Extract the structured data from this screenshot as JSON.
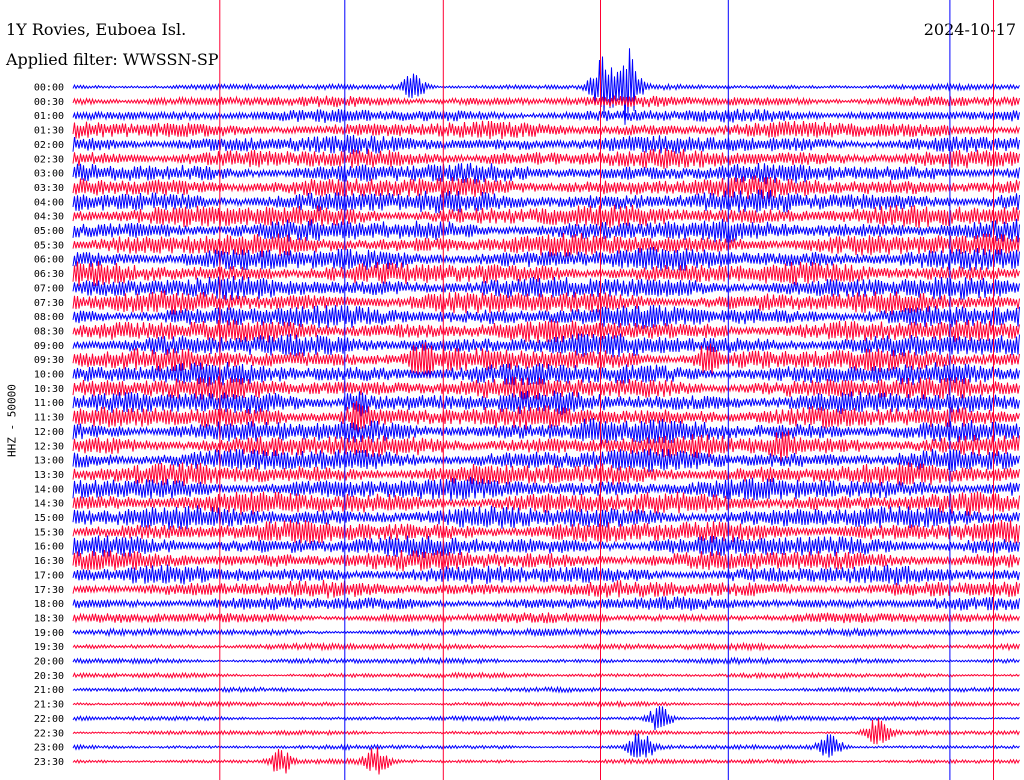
{
  "header": {
    "station": "1Y Rovies, Euboea Isl.",
    "filter": "Applied filter: WWSSN-SP",
    "date": "2024-10-17"
  },
  "chart_data": {
    "type": "line",
    "title": "1Y Rovies, Euboea Isl.",
    "subtitle": "Applied filter: WWSSN-SP",
    "date": "2024-10-17",
    "ylabel": "HHZ - 50000",
    "row_labels": [
      "00:00",
      "00:30",
      "01:00",
      "01:30",
      "02:00",
      "02:30",
      "03:00",
      "03:30",
      "04:00",
      "04:30",
      "05:00",
      "05:30",
      "06:00",
      "06:30",
      "07:00",
      "07:30",
      "08:00",
      "08:30",
      "09:00",
      "09:30",
      "10:00",
      "10:30",
      "11:00",
      "11:30",
      "12:00",
      "12:30",
      "13:00",
      "13:30",
      "14:00",
      "14:30",
      "15:00",
      "15:30",
      "16:00",
      "16:30",
      "17:00",
      "17:30",
      "18:00",
      "18:30",
      "19:00",
      "19:30",
      "20:00",
      "20:30",
      "21:00",
      "21:30",
      "22:00",
      "22:30",
      "23:00",
      "23:30"
    ],
    "colors": [
      "#0000ff",
      "#ff0033"
    ],
    "noise_level": [
      0.25,
      0.5,
      0.6,
      0.75,
      0.8,
      0.85,
      0.9,
      0.95,
      1,
      1,
      1,
      1,
      1,
      1,
      1,
      1,
      1,
      1,
      1,
      1,
      1,
      1,
      1,
      1,
      1,
      1,
      1,
      1,
      1,
      1,
      1,
      1,
      0.95,
      0.9,
      0.85,
      0.75,
      0.6,
      0.45,
      0.3,
      0.28,
      0.25,
      0.22,
      0.2,
      0.2,
      0.2,
      0.2,
      0.2,
      0.2
    ],
    "events": [
      {
        "row": 0,
        "t": 0.56,
        "amp": 2.8
      },
      {
        "row": 0,
        "t": 0.585,
        "amp": 3.6
      },
      {
        "row": 0,
        "t": 0.36,
        "amp": 1.2
      },
      {
        "row": 19,
        "t": 0.37,
        "amp": 1.4
      },
      {
        "row": 19,
        "t": 0.67,
        "amp": 1.2
      },
      {
        "row": 22,
        "t": 0.3,
        "amp": 1.0
      },
      {
        "row": 23,
        "t": 0.3,
        "amp": 1.0
      },
      {
        "row": 24,
        "t": 0.55,
        "amp": 1.0
      },
      {
        "row": 25,
        "t": 0.75,
        "amp": 1.1
      },
      {
        "row": 44,
        "t": 0.62,
        "amp": 1.2
      },
      {
        "row": 45,
        "t": 0.85,
        "amp": 1.3
      },
      {
        "row": 46,
        "t": 0.6,
        "amp": 1.4
      },
      {
        "row": 46,
        "t": 0.8,
        "amp": 1.2
      },
      {
        "row": 47,
        "t": 0.22,
        "amp": 1.2
      },
      {
        "row": 47,
        "t": 0.32,
        "amp": 1.3
      }
    ],
    "spikes": [
      {
        "t": 0.155,
        "color": "#ff0033"
      },
      {
        "t": 0.287,
        "color": "#0000ff"
      },
      {
        "t": 0.391,
        "color": "#ff0033"
      },
      {
        "t": 0.557,
        "color": "#ff0033"
      },
      {
        "t": 0.692,
        "color": "#0000ff"
      },
      {
        "t": 0.926,
        "color": "#0000ff"
      },
      {
        "t": 0.972,
        "color": "#ff0033"
      }
    ]
  }
}
